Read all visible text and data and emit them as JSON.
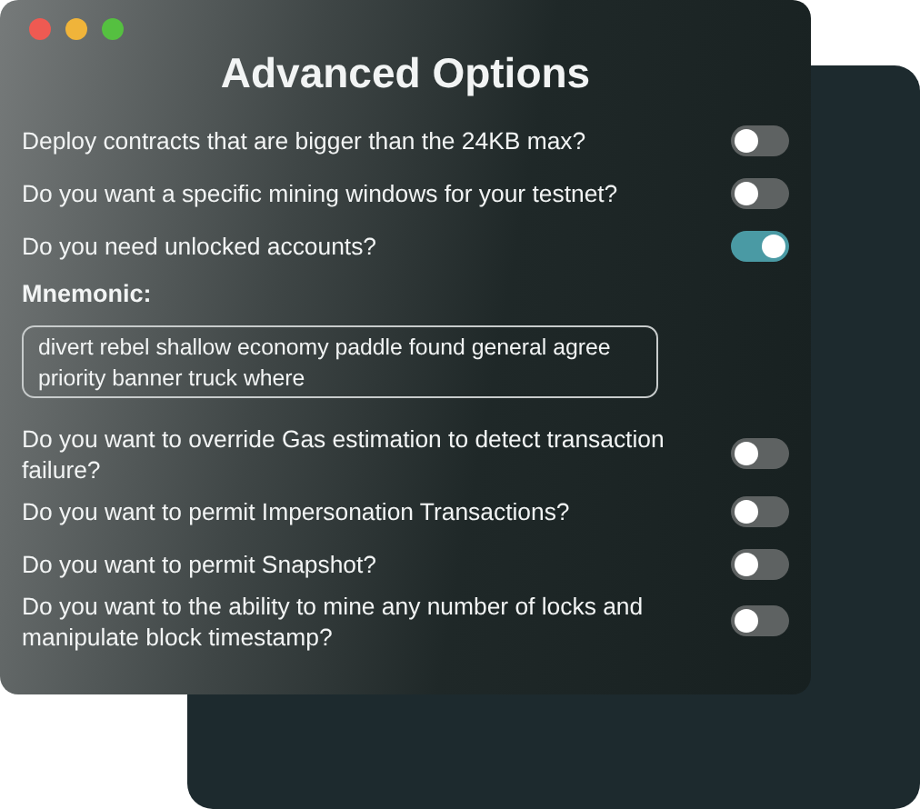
{
  "window": {
    "title": "Advanced Options"
  },
  "options": [
    {
      "kind": "toggle",
      "label": "Deploy contracts that are bigger than the 24KB max?",
      "on": false
    },
    {
      "kind": "toggle",
      "label": "Do you want a specific mining windows for your testnet?",
      "on": false
    },
    {
      "kind": "toggle",
      "label": "Do you need unlocked accounts?",
      "on": true
    },
    {
      "kind": "text",
      "label": "Mnemonic:",
      "value": "divert rebel shallow economy paddle found general agree priority banner truck where"
    },
    {
      "kind": "toggle",
      "label": "Do you want to override Gas estimation to detect transaction failure?",
      "on": false
    },
    {
      "kind": "toggle",
      "label": "Do you want to permit Impersonation Transactions?",
      "on": false
    },
    {
      "kind": "toggle",
      "label": "Do you want to permit Snapshot?",
      "on": false
    },
    {
      "kind": "toggle",
      "label": "Do you want to the ability to mine any number of locks and manipulate block timestamp?",
      "on": false
    }
  ]
}
